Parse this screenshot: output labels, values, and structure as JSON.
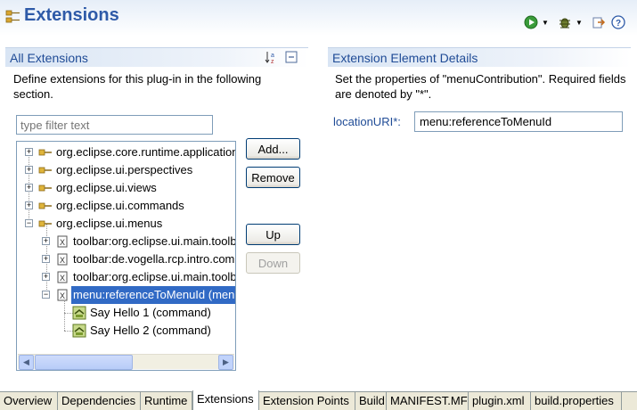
{
  "header": {
    "title": "Extensions",
    "icons": [
      "plugin-icon",
      "run-icon",
      "debug-icon",
      "export-icon",
      "help-icon"
    ]
  },
  "left": {
    "section_title": "All Extensions",
    "description": "Define extensions for this plug-in in the following section.",
    "filter_placeholder": "type filter text",
    "tree": [
      {
        "label": "org.eclipse.core.runtime.applications",
        "icon": "extension-point-icon",
        "expanded": false
      },
      {
        "label": "org.eclipse.ui.perspectives",
        "icon": "extension-point-icon",
        "expanded": false
      },
      {
        "label": "org.eclipse.ui.views",
        "icon": "extension-point-icon",
        "expanded": false
      },
      {
        "label": "org.eclipse.ui.commands",
        "icon": "extension-point-icon",
        "expanded": false
      },
      {
        "label": "org.eclipse.ui.menus",
        "icon": "extension-point-icon",
        "expanded": true
      },
      {
        "label": "toolbar:org.eclipse.ui.main.toolbar",
        "icon": "xml-element-icon",
        "expanded": false
      },
      {
        "label": "toolbar:de.vogella.rcp.intro.commands",
        "icon": "xml-element-icon",
        "expanded": false
      },
      {
        "label": "toolbar:org.eclipse.ui.main.toolbar",
        "icon": "xml-element-icon",
        "expanded": false
      },
      {
        "label": "menu:referenceToMenuId (menuContribution)",
        "icon": "xml-element-icon",
        "expanded": true,
        "selected": true
      },
      {
        "label": "Say Hello 1 (command)",
        "icon": "command-icon"
      },
      {
        "label": "Say Hello 2 (command)",
        "icon": "command-icon"
      }
    ],
    "buttons": {
      "add": "Add...",
      "remove": "Remove",
      "up": "Up",
      "down": "Down"
    }
  },
  "right": {
    "section_title": "Extension Element Details",
    "description": "Set the properties of \"menuContribution\". Required fields are denoted by \"*\".",
    "field_label": "locationURI*:",
    "field_value": "menu:referenceToMenuId"
  },
  "tabs": [
    {
      "label": "Overview"
    },
    {
      "label": "Dependencies"
    },
    {
      "label": "Runtime"
    },
    {
      "label": "Extensions",
      "active": true
    },
    {
      "label": "Extension Points"
    },
    {
      "label": "Build"
    },
    {
      "label": "MANIFEST.MF"
    },
    {
      "label": "plugin.xml"
    },
    {
      "label": "build.properties"
    }
  ],
  "colors": {
    "title": "#2e5aa8",
    "section_title": "#1f4b96",
    "selection": "#316ac5"
  }
}
